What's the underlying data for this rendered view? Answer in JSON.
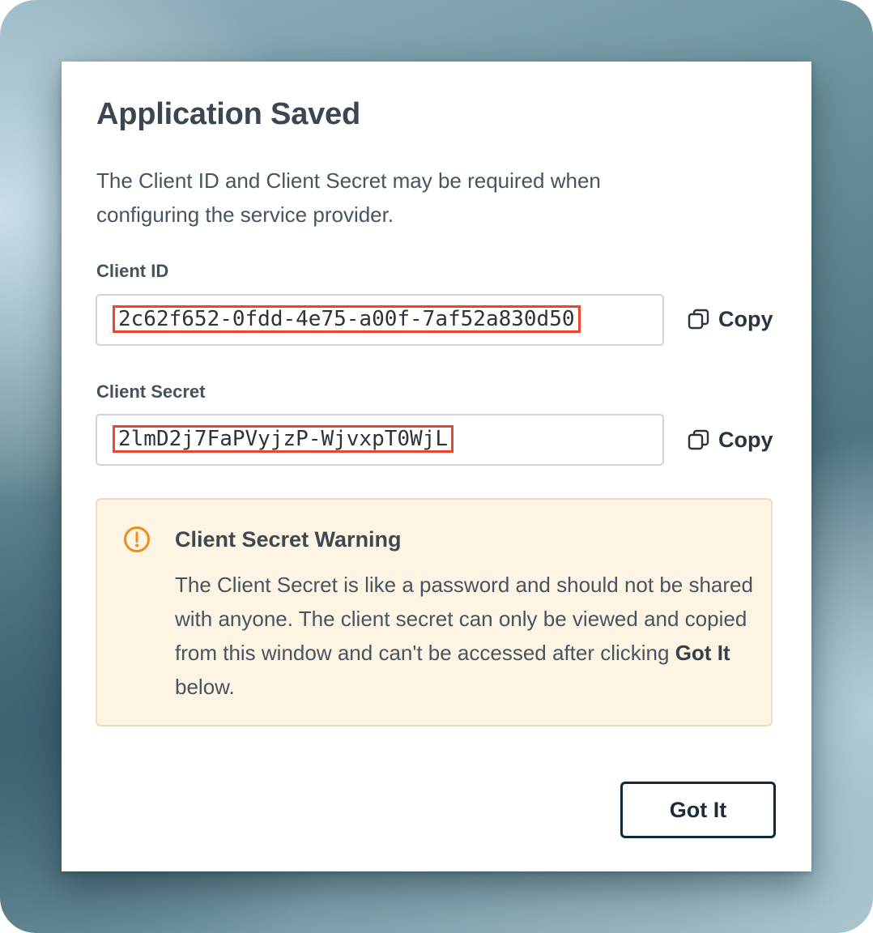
{
  "dialog": {
    "title": "Application Saved",
    "description": "The Client ID and Client Secret may be required when configuring the service provider."
  },
  "client_id": {
    "label": "Client ID",
    "value": "2c62f652-0fdd-4e75-a00f-7af52a830d50",
    "copy_label": "Copy"
  },
  "client_secret": {
    "label": "Client Secret",
    "value": "2lmD2j7FaPVyjzP-WjvxpT0WjL",
    "copy_label": "Copy"
  },
  "warning": {
    "title": "Client Secret Warning",
    "body_before": "The Client Secret is like a password and should not be shared with anyone. The client secret can only be viewed and copied from this window and can't be accessed after clicking ",
    "body_bold": "Got It",
    "body_after": " below.",
    "icon": "alert-circle-icon",
    "accent_color": "#f08c1e"
  },
  "footer": {
    "confirm_label": "Got It"
  },
  "colors": {
    "highlight_border": "#e8472d",
    "button_border": "#0f2a3a"
  }
}
